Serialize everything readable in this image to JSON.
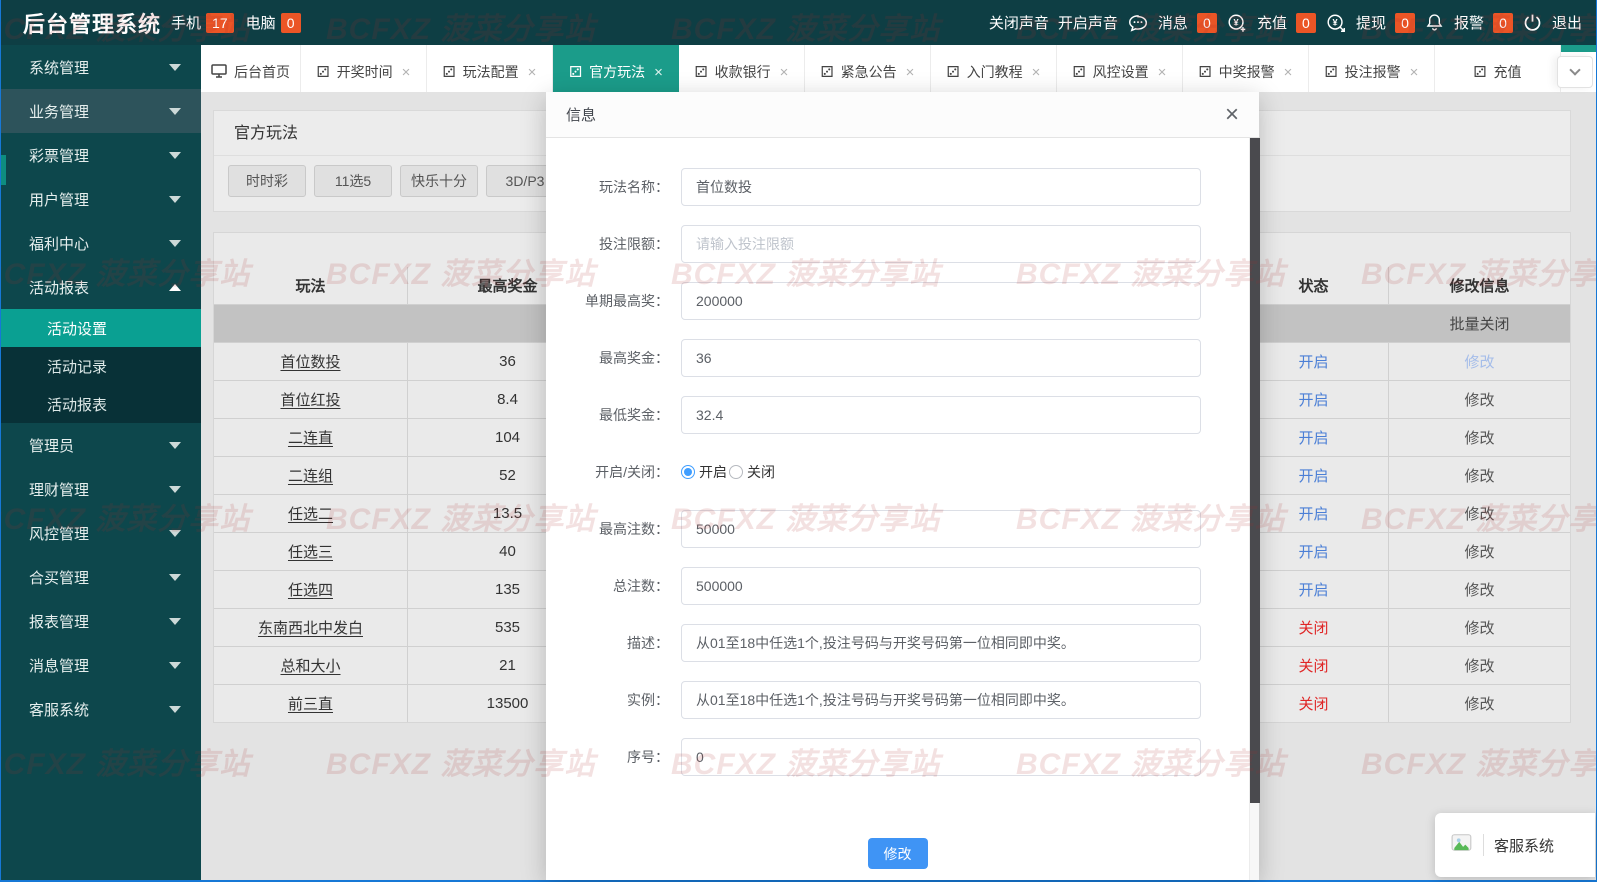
{
  "header": {
    "title": "后台管理系统",
    "phone": {
      "label": "手机",
      "count": "17"
    },
    "pc": {
      "label": "电脑",
      "count": "0"
    },
    "sound_off": "关闭声音",
    "sound_on": "开启声音",
    "message": {
      "label": "消息",
      "count": "0"
    },
    "recharge": {
      "label": "充值",
      "count": "0"
    },
    "withdraw": {
      "label": "提现",
      "count": "0"
    },
    "alarm": {
      "label": "报警",
      "count": "0"
    },
    "logout": "退出"
  },
  "icons": {
    "close": "×",
    "dice": "⚂"
  },
  "tabs": [
    {
      "label": "后台首页"
    },
    {
      "label": "开奖时间"
    },
    {
      "label": "玩法配置"
    },
    {
      "label": "官方玩法"
    },
    {
      "label": "收款银行"
    },
    {
      "label": "紧急公告"
    },
    {
      "label": "入门教程"
    },
    {
      "label": "风控设置"
    },
    {
      "label": "中奖报警"
    },
    {
      "label": "投注报警"
    },
    {
      "label": "充值"
    }
  ],
  "sidebar": {
    "items": [
      {
        "label": "系统管理"
      },
      {
        "label": "业务管理"
      },
      {
        "label": "彩票管理"
      },
      {
        "label": "用户管理"
      },
      {
        "label": "福利中心"
      },
      {
        "label": "活动报表"
      },
      {
        "label": "管理员"
      },
      {
        "label": "理财管理"
      },
      {
        "label": "风控管理"
      },
      {
        "label": "合买管理"
      },
      {
        "label": "报表管理"
      },
      {
        "label": "消息管理"
      },
      {
        "label": "客服系统"
      }
    ],
    "submenu": [
      {
        "label": "活动设置"
      },
      {
        "label": "活动记录"
      },
      {
        "label": "活动报表"
      }
    ]
  },
  "content": {
    "panel_title": "官方玩法",
    "lottery_tabs": [
      "时时彩",
      "11选5",
      "快乐十分",
      "3D/P3"
    ],
    "table": {
      "col_play": "玩法",
      "col_prize": "最高奖金",
      "col_status": "状态",
      "col_modify": "修改信息",
      "batch_action": "批量关闭",
      "action_label": "修改",
      "rows": [
        {
          "name": "首位数投",
          "prize": "36",
          "status": "开启",
          "state": "open"
        },
        {
          "name": "首位红投",
          "prize": "8.4",
          "status": "开启",
          "state": "open"
        },
        {
          "name": "二连直",
          "prize": "104",
          "status": "开启",
          "state": "open"
        },
        {
          "name": "二连组",
          "prize": "52",
          "status": "开启",
          "state": "open"
        },
        {
          "name": "任选二",
          "prize": "13.5",
          "status": "开启",
          "state": "open"
        },
        {
          "name": "任选三",
          "prize": "40",
          "status": "开启",
          "state": "open"
        },
        {
          "name": "任选四",
          "prize": "135",
          "status": "开启",
          "state": "open"
        },
        {
          "name": "东南西北中发白",
          "prize": "535",
          "status": "关闭",
          "state": "closed"
        },
        {
          "name": "总和大小",
          "prize": "21",
          "status": "关闭",
          "state": "closed"
        },
        {
          "name": "前三直",
          "prize": "13500",
          "status": "关闭",
          "state": "closed"
        }
      ]
    }
  },
  "modal": {
    "title": "信息",
    "fields": {
      "name": {
        "label": "玩法名称：",
        "value": "首位数投"
      },
      "limit": {
        "label": "投注限额：",
        "placeholder": "请输入投注限额"
      },
      "max_prize_period": {
        "label": "单期最高奖：",
        "value": "200000"
      },
      "max_prize": {
        "label": "最高奖金：",
        "value": "36"
      },
      "min_prize": {
        "label": "最低奖金：",
        "value": "32.4"
      },
      "switch": {
        "label": "开启/关闭：",
        "on": "开启",
        "off": "关闭",
        "selected": "开启"
      },
      "max_bets": {
        "label": "最高注数：",
        "value": "50000"
      },
      "total_bets": {
        "label": "总注数：",
        "value": "500000"
      },
      "desc": {
        "label": "描述：",
        "value": "从01至18中任选1个,投注号码与开奖号码第一位相同即中奖。"
      },
      "example": {
        "label": "实例：",
        "value": "从01至18中任选1个,投注号码与开奖号码第一位相同即中奖。"
      },
      "order": {
        "label": "序号：",
        "value": "0"
      }
    },
    "submit": "修改"
  },
  "widget": {
    "label": "客服系统"
  },
  "watermark": {
    "brand": "BCFXZ",
    "site": "菠菜分享站"
  }
}
